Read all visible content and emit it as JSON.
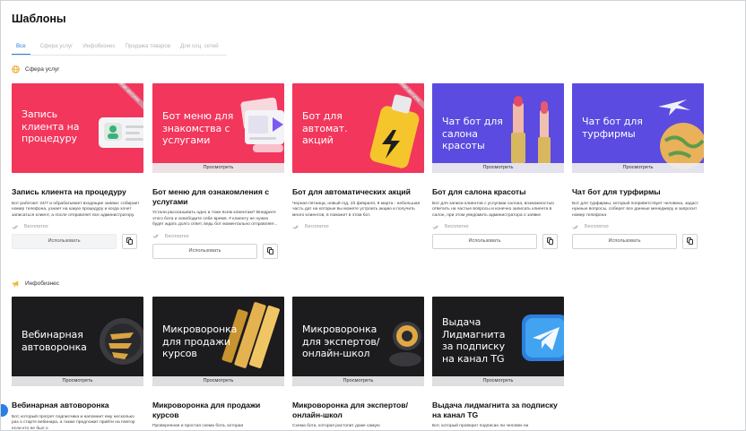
{
  "page": {
    "title": "Шаблоны"
  },
  "tabs": [
    {
      "label": "Все",
      "active": true
    },
    {
      "label": "Сфера услуг"
    },
    {
      "label": "Инфобизнес"
    },
    {
      "label": "Продажа товаров"
    },
    {
      "label": "Для соц. сетей"
    }
  ],
  "sections": [
    {
      "label": "Сфера услуг",
      "icon": "globe-icon",
      "cards": [
        {
          "banner_text": "Запись клиента на процедуру",
          "banner_bar": "",
          "badge": "Скоро доступно",
          "title": "Запись клиента на процедуру",
          "desc": "Бот работает 24/7 и обрабатывает входящие заявки: собирает номер телефона, узнает на какую процедуру и когда хочет записаться клиент, а после отправляет все администратору.",
          "price": "Бесплатно",
          "use_label": "Использовать"
        },
        {
          "banner_text": "Бот меню для знакомства с услугами",
          "banner_bar": "Просмотреть",
          "badge": "",
          "title": "Бот меню для ознакомления с услугами",
          "desc": "Устали рассказывать одно и тоже всем клиентам? Внедрите этого бота и освободите себе время. # клиенту не нужно будет ждать долго ответ, ведь бот моментально отправляет...",
          "price": "Бесплатно",
          "use_label": "Использовать"
        },
        {
          "banner_text": "Бот для автомат. акций",
          "banner_bar": "",
          "badge": "Скоро доступно",
          "title": "Бот для автоматических акций",
          "desc": "Черная пятница, новый год, 23 февраля, 8 марта - небольшая часть дат на которые вы можете устроить акцию и получить много клиентов, в поможет в этом бот.",
          "price": "Бесплатно",
          "use_label": "Использовать"
        },
        {
          "banner_text": "Чат бот для салона красоты",
          "banner_bar": "Просмотреть",
          "badge": "",
          "title": "Бот для салона красоты",
          "desc": "Бот для записи клиентов с услугами салона, возможностью ответить на частые вопросы и конечно записать клиента в салон, при этом уведомить администратора о заявке",
          "price": "Бесплатно",
          "use_label": "Использовать"
        },
        {
          "banner_text": "Чат бот для турфирмы",
          "banner_bar": "Просмотреть",
          "badge": "",
          "title": "Чат бот для турфирмы",
          "desc": "Бот для турфирмы, который поприветствует человека, задаст нужные вопросы, соберет все данные менеджеру и запросит номер телефона",
          "price": "Бесплатно",
          "use_label": "Использовать"
        }
      ]
    },
    {
      "label": "Инфобизнес",
      "icon": "megaphone-icon",
      "cards": [
        {
          "banner_text": "Вебинарная автоворонка",
          "banner_bar": "Просмотреть",
          "title": "Вебинарная автоворонка",
          "desc": "Бот, который прогрет подписчика и напомнит ему несколько раз о старте вебинара, а также предложит прийти на повтор если кто не был о"
        },
        {
          "banner_text": "Микроворонка для продажи курсов",
          "banner_bar": "Просмотреть",
          "title": "Микроворонка для продажи курсов",
          "desc": "Проверенная и простая схема бота, которая"
        },
        {
          "banner_text": "Микроворонка для экспертов/ онлайн-школ",
          "banner_bar": "Просмотреть",
          "title": "Микроворонка для экспертов/онлайн-школ",
          "desc": "Схема бота, которая растопит даже самую"
        },
        {
          "banner_text": "Выдача Лидмагнита за подписку на канал TG",
          "banner_bar": "Просмотреть",
          "title": "Выдача лидмагнита за подписку на канал TG",
          "desc": "Бот, который проверит подписан ли человек на"
        }
      ]
    }
  ],
  "colors": {
    "accent": "#2b7fe0",
    "pink_banner": "#f2365c",
    "violet_banner": "#5b4be0",
    "dark_banner": "#1c1c1e"
  }
}
